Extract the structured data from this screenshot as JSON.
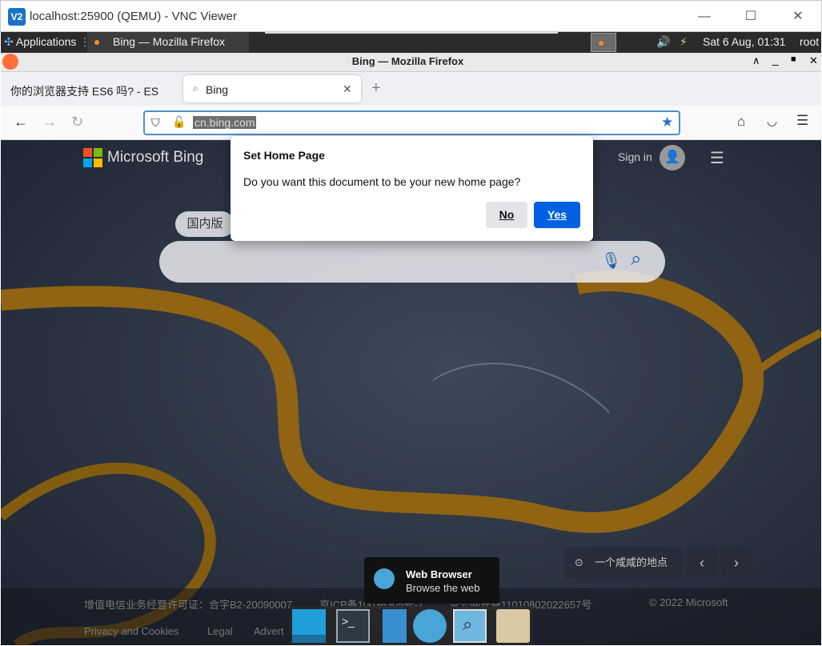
{
  "vnc": {
    "logo": "V2",
    "title": "localhost:25900 (QEMU) - VNC Viewer",
    "minimize": "—",
    "maximize": "☐",
    "close": "✕"
  },
  "panel": {
    "applications": "Applications",
    "task": "Bing — Mozilla Firefox",
    "clock": "Sat  6 Aug, 01:31",
    "user": "root"
  },
  "firefox": {
    "title": "Bing — Mozilla Firefox",
    "tabs": [
      {
        "label": "你的浏览器支持 ES6 吗? - ES"
      },
      {
        "label": "Bing"
      }
    ],
    "new_tab": "+",
    "url": "cn.bing.com"
  },
  "dialog": {
    "title": "Set Home Page",
    "message": "Do you want this document to be your new home page?",
    "no_label": "No",
    "yes_label": "Yes"
  },
  "bing": {
    "logo_text": "Microsoft Bing",
    "sign_in": "Sign in",
    "region": "国内版",
    "location": "一个咸咸的地点",
    "footer_line1": [
      "增值电信业务经营许可证：合字B2-20090007",
      "京ICP备10036305号-7",
      "京公网安备11010802022657号",
      "© 2022 Microsoft"
    ],
    "footer_line2": [
      "Privacy and Cookies",
      "Legal",
      "Advert"
    ]
  },
  "tooltip": {
    "title": "Web Browser",
    "subtitle": "Browse the web"
  },
  "colors": {
    "accent": "#0060df",
    "panel": "#2b2b2b",
    "river": "#d8a020"
  }
}
